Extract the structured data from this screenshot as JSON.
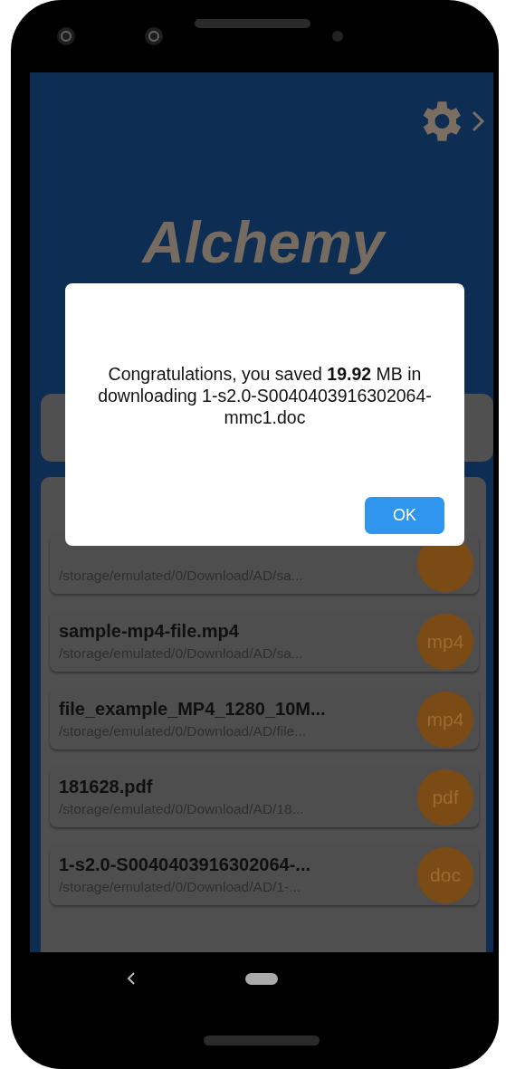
{
  "app": {
    "title": "Alchemy"
  },
  "downloads": [
    {
      "path": "/storage/emulated/0/Download/AD/sa..."
    },
    {
      "name": "sample-mp4-file.mp4",
      "path": "/storage/emulated/0/Download/AD/sa...",
      "ext": "mp4"
    },
    {
      "name": "file_example_MP4_1280_10M...",
      "path": "/storage/emulated/0/Download/AD/file...",
      "ext": "mp4"
    },
    {
      "name": "181628.pdf",
      "path": "/storage/emulated/0/Download/AD/18...",
      "ext": "pdf"
    },
    {
      "name": "1-s2.0-S0040403916302064-...",
      "path": "/storage/emulated/0/Download/AD/1-...",
      "ext": "doc"
    }
  ],
  "dialog": {
    "message": "Congratulations, you saved **19.92** MB in downloading 1-s2.0-S0040403916302064-mmc1.doc",
    "button": "OK"
  }
}
